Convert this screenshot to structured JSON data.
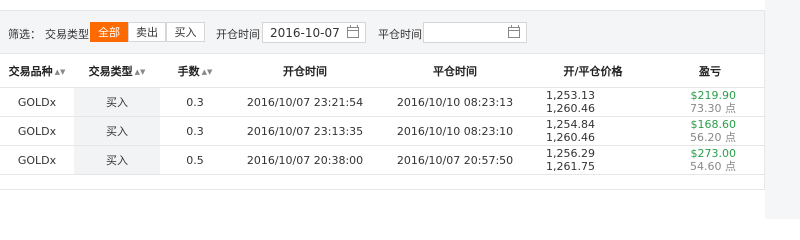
{
  "filter": {
    "label": "筛选：",
    "type_label": "交易类型",
    "segments": [
      {
        "label": "全部",
        "active": true
      },
      {
        "label": "卖出",
        "active": false
      },
      {
        "label": "买入",
        "active": false
      }
    ],
    "open_time_label": "开仓时间",
    "open_time_value": "2016-10-07",
    "close_time_label": "平仓时间",
    "close_time_value": ""
  },
  "table": {
    "headers": [
      "交易品种",
      "交易类型",
      "手数",
      "开仓时间",
      "平仓时间",
      "开/平仓价格",
      "盈亏"
    ],
    "rows": [
      {
        "symbol": "GOLDx",
        "type": "买入",
        "lots": "0.3",
        "open_time": "2016/10/07 23:21:54",
        "close_time": "2016/10/10 08:23:13",
        "open_price": "1,253.13",
        "close_price": "1,260.46",
        "profit": "$219.90",
        "points": "73.30 点"
      },
      {
        "symbol": "GOLDx",
        "type": "买入",
        "lots": "0.3",
        "open_time": "2016/10/07 23:13:35",
        "close_time": "2016/10/10 08:23:10",
        "open_price": "1,254.84",
        "close_price": "1,260.46",
        "profit": "$168.60",
        "points": "56.20 点"
      },
      {
        "symbol": "GOLDx",
        "type": "买入",
        "lots": "0.5",
        "open_time": "2016/10/07 20:38:00",
        "close_time": "2016/10/07 20:57:50",
        "open_price": "1,256.29",
        "close_price": "1,261.75",
        "profit": "$273.00",
        "points": "54.60 点"
      }
    ]
  },
  "colors": {
    "accent": "#ff6a00",
    "profit": "#2a9e4a"
  },
  "icons": {
    "sort": "sort-arrows-icon",
    "calendar": "calendar-icon"
  }
}
